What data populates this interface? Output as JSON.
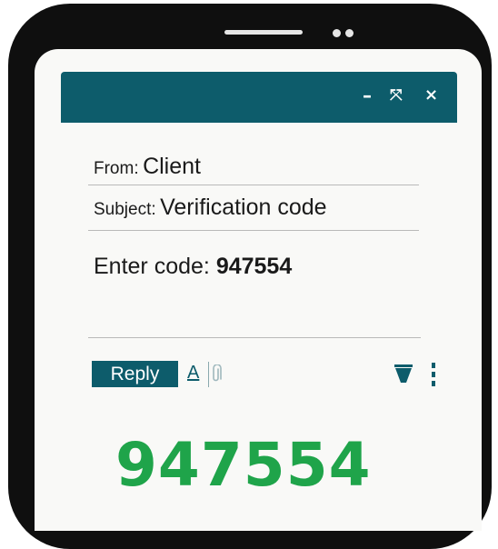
{
  "window": {
    "minimize_label": "–",
    "maximize_label": "⤧",
    "close_label": "×"
  },
  "email": {
    "from_label": "From:",
    "from_value": "Client",
    "subject_label": "Subject:",
    "subject_value": "Verification code",
    "body_prefix": "Enter code:",
    "body_code": "947554"
  },
  "toolbar": {
    "reply_label": "Reply",
    "font_label": "A",
    "icons": [
      "font-format-icon",
      "paperclip-icon",
      "trash-icon",
      "more-vertical-icon"
    ]
  },
  "highlight_code": "947554",
  "colors": {
    "accent": "#0d5c6b",
    "code_green": "#1fa44a",
    "phone_frame": "#0f0f0f"
  }
}
